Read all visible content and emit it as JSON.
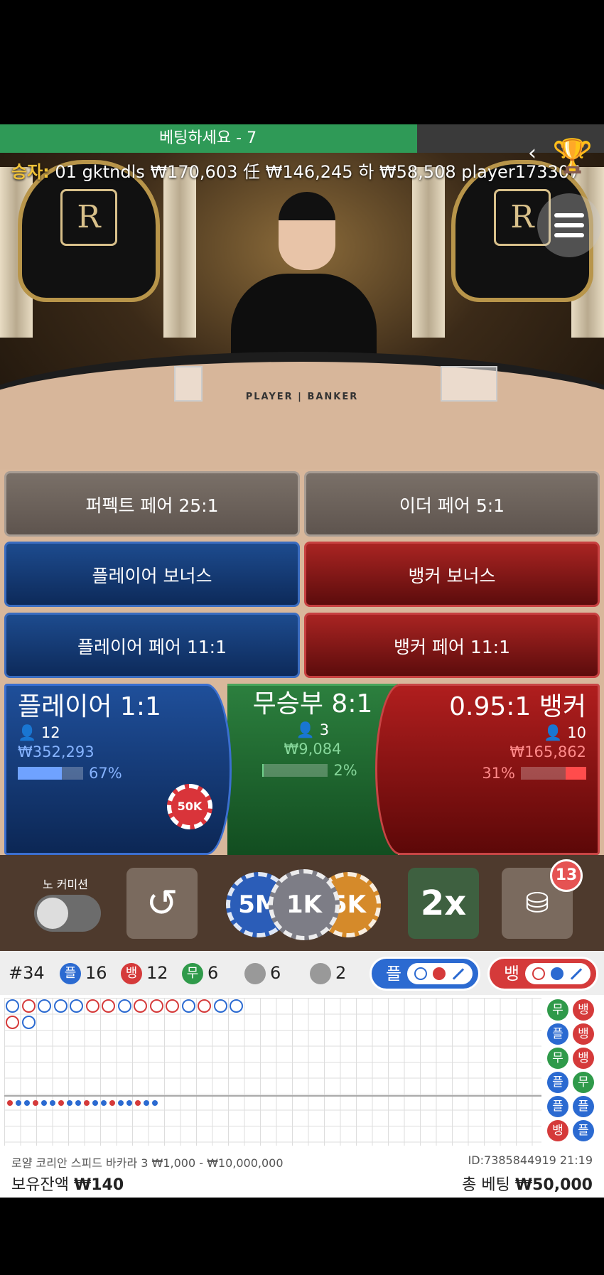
{
  "status": {
    "countdown_label": "베팅하세요 - 7",
    "countdown_progress_fraction": 0.69
  },
  "ticker": {
    "label": "승자:",
    "text": "01 gktndls   ₩170,603 任   ₩146,245 하   ₩58,508 player173307"
  },
  "video": {
    "table_print": "PLAYER | BANKER",
    "seat_logo": "R"
  },
  "icons": {
    "back": "chevron-left-icon",
    "trophy": "trophy-icon",
    "menu": "hamburger-menu-icon"
  },
  "side_bets": [
    {
      "label": "퍼펙트 페어 25:1"
    },
    {
      "label": "이더 페어 5:1"
    },
    {
      "label": "플레이어 보너스"
    },
    {
      "label": "뱅커 보너스"
    },
    {
      "label": "플레이어 페어 11:1"
    },
    {
      "label": "뱅커 페어 11:1"
    }
  ],
  "main_bets": {
    "player": {
      "title": "플레이어 1:1",
      "count": "12",
      "amount": "₩352,293",
      "percent": "67%",
      "percent_value": 67,
      "chip": "50K"
    },
    "tie": {
      "title": "무승부 8:1",
      "count": "3",
      "amount": "₩9,084",
      "percent": "2%",
      "percent_value": 2
    },
    "banker": {
      "title": "0.95:1 뱅커",
      "count": "10",
      "amount": "₩165,862",
      "percent": "31%",
      "percent_value": 31
    }
  },
  "controls": {
    "no_commission_label": "노 커미션",
    "no_commission_on": false,
    "undo_glyph": "↺",
    "chips": [
      "5M",
      "1K",
      "5K"
    ],
    "double_label": "2x",
    "chip_stack_badge": "13"
  },
  "colors": {
    "player": "#2b6ad1",
    "banker": "#d53a3a",
    "tie": "#2f9a4a",
    "progress": "#2f9a57"
  },
  "scoreboard": {
    "round": "#34",
    "player_label": "플",
    "player_count": "16",
    "banker_label": "뱅",
    "banker_count": "12",
    "tie_label": "무",
    "tie_count": "6",
    "player_pair_count": "6",
    "banker_pair_count": "2",
    "predict_player_label": "플",
    "predict_banker_label": "뱅",
    "side_column": [
      "무",
      "뱅",
      "플",
      "뱅",
      "무",
      "뱅",
      "플",
      "무",
      "플",
      "플",
      "뱅",
      "플"
    ]
  },
  "footer": {
    "table_info": "로얄 코리안 스피드 바카라 3 ₩1,000 - ₩10,000,000",
    "id_info": "ID:7385844919 21:19",
    "balance_label": "보유잔액",
    "balance_value": "₩140",
    "total_bet_label": "총 베팅",
    "total_bet_value": "₩50,000"
  }
}
